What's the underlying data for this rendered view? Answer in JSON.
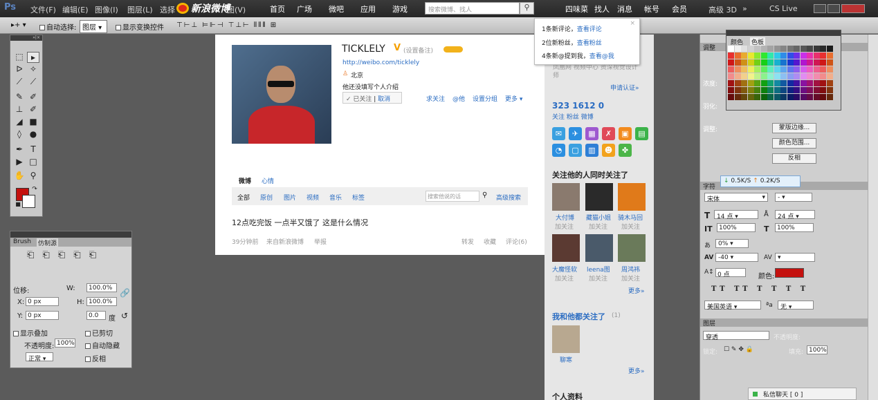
{
  "menubar": {
    "ps": "Ps",
    "file": "文件(F)",
    "edit": "编辑(E)",
    "image": "图像(I)",
    "layer": "图层(L)",
    "select": "选择",
    "view": "图(V)",
    "sina": "新浪微博",
    "home": "首页",
    "square": "广场",
    "weiba": "微吧",
    "apps": "应用",
    "games": "游戏",
    "search_placeholder": "搜索微博、找人",
    "user": "四味菜",
    "find": "找人",
    "msg": "消息",
    "account": "帐号",
    "member": "会员",
    "essentials": "高级 3D",
    "more": "»",
    "cslive": "CS Live"
  },
  "options": {
    "autoselect": "自动选择:",
    "autoselect_value": "图层",
    "transform": "显示变换控件"
  },
  "profile": {
    "name": "TICKLELY",
    "remark": "(设置备注)",
    "url": "http://weibo.com/ticklely",
    "location": "北京",
    "bio": "他还没填写个人介绍",
    "follow_state": "✓ 已关注",
    "cancel": "取消",
    "ask": "求关注",
    "at": "@他",
    "group": "设置分组",
    "more": "更多 ▾"
  },
  "tabs": {
    "weibo": "微博",
    "heart": "心情",
    "all": "全部",
    "orig": "原创",
    "pics": "图片",
    "video": "视频",
    "music": "音乐",
    "tags": "标签",
    "search_ph": "搜索他说的话",
    "adv": "高级搜索"
  },
  "post": {
    "text": "12点吃完饭 一点半又饿了 这是什么情况",
    "time": "39分钟前",
    "source": "来自新浪微博",
    "report": "举报",
    "forward": "转发",
    "fav": "收藏",
    "comment": "评论(6)"
  },
  "notify": {
    "l1a": "1条新评论，",
    "l1b": "查看评论",
    "l2a": "2位新粉丝，",
    "l2b": "查看粉丝",
    "l3a": "4条新@提到我，",
    "l3b": "查看@我",
    "close": "×"
  },
  "sidebar": {
    "intro": "凤凰网 视频中心 资深视觉设计师",
    "verify": "申请认证»",
    "stats": "323 1612 0",
    "stat_labels": "关注 粉丝 微博",
    "mutual": "关注他的人同时关注了",
    "follow": "加关注",
    "more": "更多»",
    "both": "我和他都关注了",
    "both_count": "(1)",
    "both_user": "聊寒",
    "profile": "个人资料",
    "users": [
      "大付博",
      "藏猫小姐",
      "骑木马回",
      "大魔怪软",
      "leena图",
      "周鸿祎"
    ]
  },
  "clone": {
    "tab1": "Brush",
    "tab2": "仿制源",
    "offset": "位移:",
    "w": "W:",
    "wv": "100.0%",
    "h": "H:",
    "hv": "100.0%",
    "x": "X:",
    "xv": "0 px",
    "y": "Y:",
    "yv": "0 px",
    "angle": "0.0",
    "deg": "度",
    "overlay": "显示叠加",
    "clip": "已剪切",
    "opacity": "不透明度:",
    "opv": "100%",
    "autohide": "自动隐藏",
    "mode": "正常",
    "invert": "反相"
  },
  "panels": {
    "adj": "调整",
    "swatch_tab1": "颜色",
    "swatch_tab2": "色板",
    "mask1": "蒙版边缘...",
    "mask2": "颜色范围...",
    "mask3": "反相",
    "density": "浓度:",
    "feather": "羽化:",
    "refine": "调整:",
    "char": "字符",
    "font": "宋体",
    "size": "14 点",
    "leading": "24 点",
    "scale": "100%",
    "scaleh": "100%",
    "baseline": "0%",
    "track": "-40",
    "shift": "0 点",
    "colorlbl": "颜色:",
    "lang": "美国英语",
    "aa": "无",
    "layers": "图层",
    "blend": "穿透",
    "opacity": "不透明度:",
    "lock": "锁定:",
    "fill": "填充:",
    "fillv": "100%"
  },
  "speed": {
    "down": "0.5K/S",
    "up": "0.2K/S"
  },
  "chat": {
    "label": "私信聊天 [ 0 ]"
  },
  "colors": {
    "fg": "#c4110e",
    "accent": "#2a6cc2"
  }
}
